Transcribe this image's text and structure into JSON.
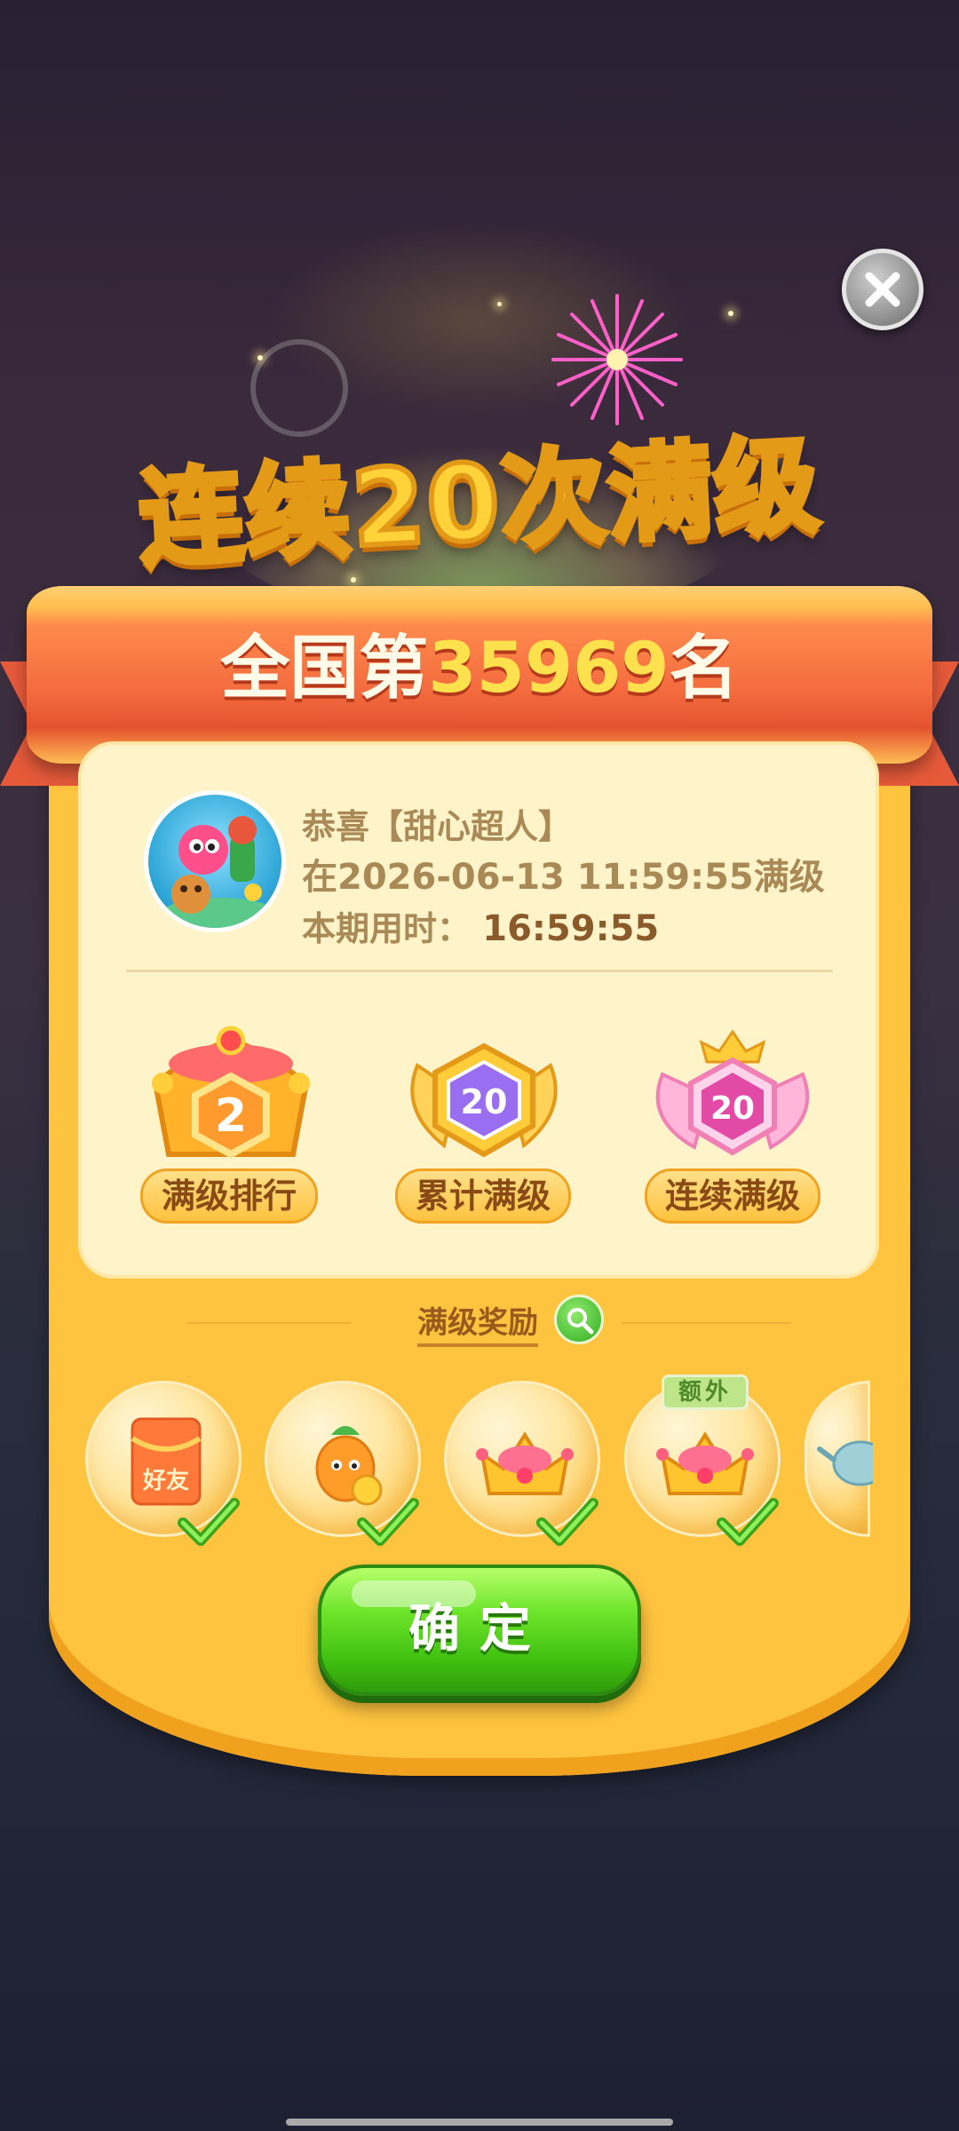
{
  "close_icon": "close-x-icon",
  "title": "连续20次满级",
  "ribbon": {
    "prefix": "全国第",
    "number": "35969",
    "suffix": "名"
  },
  "profile": {
    "greeting": "恭喜【甜心超人】",
    "completed_at": "在2026-06-13 11:59:55满级",
    "time_label": "本期用时：",
    "time_value": "16:59:55"
  },
  "badges": [
    {
      "number": "2",
      "label": "满级排行",
      "icon": "crown-badge-icon"
    },
    {
      "number": "20",
      "label": "累计满级",
      "icon": "winged-purple-badge-icon"
    },
    {
      "number": "20",
      "label": "连续满级",
      "icon": "winged-pink-badge-icon"
    }
  ],
  "rewards": {
    "title": "满级奖励",
    "items": [
      {
        "icon": "red-envelope-icon",
        "text": "好友",
        "claimed": true
      },
      {
        "icon": "lollipop-character-icon",
        "claimed": true
      },
      {
        "icon": "crown-icon",
        "claimed": true
      },
      {
        "icon": "crown-icon",
        "claimed": true,
        "tag": "额外"
      },
      {
        "icon": "teapot-icon"
      }
    ]
  },
  "confirm_label": "确定",
  "colors": {
    "panel": "#ffc43f",
    "ribbon": "#f36a3e",
    "confirm": "#3fbf10",
    "title": "#ffd23a"
  }
}
